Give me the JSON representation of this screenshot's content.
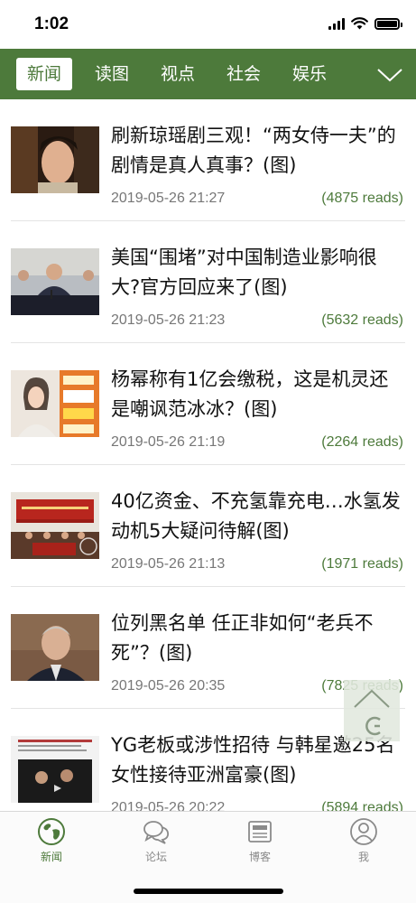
{
  "status_bar": {
    "time": "1:02",
    "icons": [
      "signal-icon",
      "wifi-icon",
      "battery-icon"
    ]
  },
  "categories": {
    "tabs": [
      {
        "label": "新闻",
        "active": true
      },
      {
        "label": "读图",
        "active": false
      },
      {
        "label": "视点",
        "active": false
      },
      {
        "label": "社会",
        "active": false
      },
      {
        "label": "娱乐",
        "active": false
      }
    ],
    "expand_icon": "chevron-down-icon"
  },
  "news": [
    {
      "title": "刷新琼瑶剧三观！“两女侍一夫”的剧情是真人真事？(图)",
      "date": "2019-05-26 21:27",
      "reads": "(4875 reads)"
    },
    {
      "title": "美国“围堵”对中国制造业影响很大?官方回应来了(图)",
      "date": "2019-05-26 21:23",
      "reads": "(5632 reads)"
    },
    {
      "title": "杨幂称有1亿会缴税，这是机灵还是嘲讽范冰冰？(图)",
      "date": "2019-05-26 21:19",
      "reads": "(2264 reads)"
    },
    {
      "title": "40亿资金、不充氢靠充电…水氢发动机5大疑问待解(图)",
      "date": "2019-05-26 21:13",
      "reads": "(1971 reads)"
    },
    {
      "title": "位列黑名单 任正非如何“老兵不死”？(图)",
      "date": "2019-05-26 20:35",
      "reads": "(7825 reads)"
    },
    {
      "title": "YG老板或涉性招待 与韩星邀25名女性接待亚洲富豪(图)",
      "date": "2019-05-26 20:22",
      "reads": "(5894 reads)"
    }
  ],
  "scroll_top_icon": "chevron-up-icon",
  "tab_bar": {
    "items": [
      {
        "label": "新闻",
        "icon": "globe-icon",
        "active": true
      },
      {
        "label": "论坛",
        "icon": "chat-bubbles-icon",
        "active": false
      },
      {
        "label": "博客",
        "icon": "newspaper-icon",
        "active": false
      },
      {
        "label": "我",
        "icon": "user-icon",
        "active": false
      }
    ]
  },
  "colors": {
    "accent": "#4d7a3b",
    "reads_text": "#4d7a3b",
    "date_text": "#777777"
  }
}
